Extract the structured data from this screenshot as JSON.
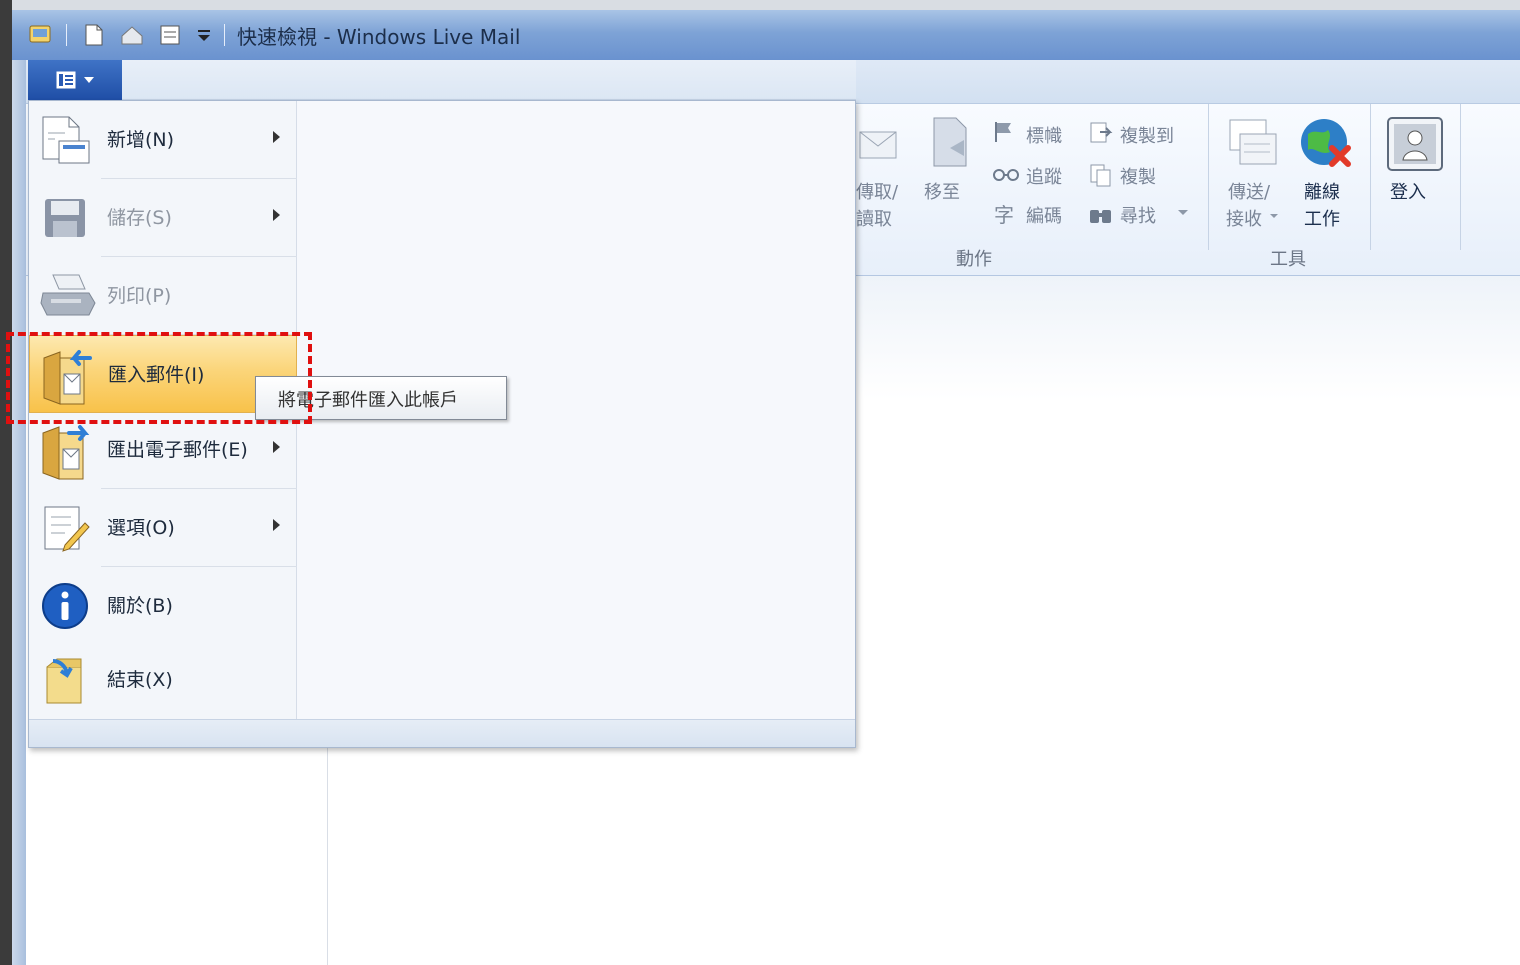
{
  "window": {
    "title": "快速檢視 - Windows Live Mail"
  },
  "ribbon": {
    "send_receive_partial_line1": "傳取/",
    "send_receive_partial_line2": "讀取",
    "move_to": "移至",
    "flag": "標幟",
    "watch": "追蹤",
    "encoding": "編碼",
    "copy_to": "複製到",
    "copy": "複製",
    "find": "尋找",
    "send_receive_line1": "傳送/",
    "send_receive_line2": "接收",
    "work_offline_line1": "離線",
    "work_offline_line2": "工作",
    "sign_in": "登入",
    "group_actions": "動作",
    "group_tools": "工具"
  },
  "file_menu": {
    "items": [
      {
        "label": "新增(N)",
        "icon": "new-document-icon",
        "submenu": true,
        "disabled": false
      },
      {
        "label": "儲存(S)",
        "icon": "save-icon",
        "submenu": true,
        "disabled": true
      },
      {
        "label": "列印(P)",
        "icon": "printer-icon",
        "submenu": false,
        "disabled": true
      },
      {
        "label": "匯入郵件(I)",
        "icon": "import-mail-icon",
        "submenu": false,
        "disabled": false,
        "highlighted": true
      },
      {
        "label": "匯出電子郵件(E)",
        "icon": "export-mail-icon",
        "submenu": true,
        "disabled": false
      },
      {
        "label": "選項(O)",
        "icon": "options-icon",
        "submenu": true,
        "disabled": false
      },
      {
        "label": "關於(B)",
        "icon": "info-icon",
        "submenu": false,
        "disabled": false
      },
      {
        "label": "結束(X)",
        "icon": "exit-icon",
        "submenu": false,
        "disabled": false
      }
    ]
  },
  "tooltip": {
    "text": "將電子郵件匯入此帳戶"
  },
  "colors": {
    "highlight_border": "#e01010",
    "menu_button": "#2a5bb4",
    "selected_item": "#f9cf6a"
  }
}
